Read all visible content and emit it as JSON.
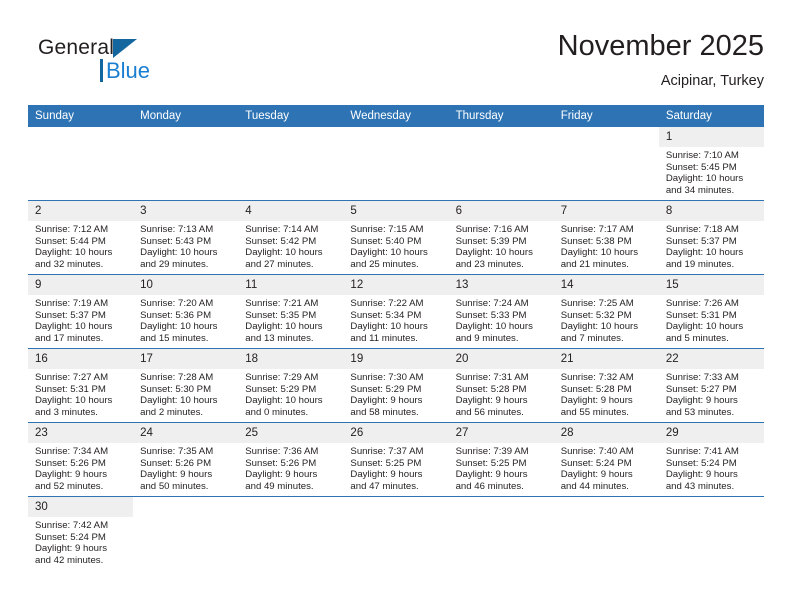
{
  "brand": {
    "name_top": "General",
    "name_bottom": "Blue",
    "accent_color": "#14679e",
    "blue_text_color": "#1b7fd1"
  },
  "header": {
    "month_title": "November 2025",
    "location": "Acipinar, Turkey"
  },
  "theme": {
    "header_blue": "#2e74b5",
    "daynum_gray": "#efefef",
    "text": "#231f20"
  },
  "weekday_headers": [
    "Sunday",
    "Monday",
    "Tuesday",
    "Wednesday",
    "Thursday",
    "Friday",
    "Saturday"
  ],
  "weeks": [
    [
      {
        "day": "",
        "empty": true
      },
      {
        "day": "",
        "empty": true
      },
      {
        "day": "",
        "empty": true
      },
      {
        "day": "",
        "empty": true
      },
      {
        "day": "",
        "empty": true
      },
      {
        "day": "",
        "empty": true
      },
      {
        "day": "1",
        "sunrise": "Sunrise: 7:10 AM",
        "sunset": "Sunset: 5:45 PM",
        "daylight_1": "Daylight: 10 hours",
        "daylight_2": "and 34 minutes."
      }
    ],
    [
      {
        "day": "2",
        "sunrise": "Sunrise: 7:12 AM",
        "sunset": "Sunset: 5:44 PM",
        "daylight_1": "Daylight: 10 hours",
        "daylight_2": "and 32 minutes."
      },
      {
        "day": "3",
        "sunrise": "Sunrise: 7:13 AM",
        "sunset": "Sunset: 5:43 PM",
        "daylight_1": "Daylight: 10 hours",
        "daylight_2": "and 29 minutes."
      },
      {
        "day": "4",
        "sunrise": "Sunrise: 7:14 AM",
        "sunset": "Sunset: 5:42 PM",
        "daylight_1": "Daylight: 10 hours",
        "daylight_2": "and 27 minutes."
      },
      {
        "day": "5",
        "sunrise": "Sunrise: 7:15 AM",
        "sunset": "Sunset: 5:40 PM",
        "daylight_1": "Daylight: 10 hours",
        "daylight_2": "and 25 minutes."
      },
      {
        "day": "6",
        "sunrise": "Sunrise: 7:16 AM",
        "sunset": "Sunset: 5:39 PM",
        "daylight_1": "Daylight: 10 hours",
        "daylight_2": "and 23 minutes."
      },
      {
        "day": "7",
        "sunrise": "Sunrise: 7:17 AM",
        "sunset": "Sunset: 5:38 PM",
        "daylight_1": "Daylight: 10 hours",
        "daylight_2": "and 21 minutes."
      },
      {
        "day": "8",
        "sunrise": "Sunrise: 7:18 AM",
        "sunset": "Sunset: 5:37 PM",
        "daylight_1": "Daylight: 10 hours",
        "daylight_2": "and 19 minutes."
      }
    ],
    [
      {
        "day": "9",
        "sunrise": "Sunrise: 7:19 AM",
        "sunset": "Sunset: 5:37 PM",
        "daylight_1": "Daylight: 10 hours",
        "daylight_2": "and 17 minutes."
      },
      {
        "day": "10",
        "sunrise": "Sunrise: 7:20 AM",
        "sunset": "Sunset: 5:36 PM",
        "daylight_1": "Daylight: 10 hours",
        "daylight_2": "and 15 minutes."
      },
      {
        "day": "11",
        "sunrise": "Sunrise: 7:21 AM",
        "sunset": "Sunset: 5:35 PM",
        "daylight_1": "Daylight: 10 hours",
        "daylight_2": "and 13 minutes."
      },
      {
        "day": "12",
        "sunrise": "Sunrise: 7:22 AM",
        "sunset": "Sunset: 5:34 PM",
        "daylight_1": "Daylight: 10 hours",
        "daylight_2": "and 11 minutes."
      },
      {
        "day": "13",
        "sunrise": "Sunrise: 7:24 AM",
        "sunset": "Sunset: 5:33 PM",
        "daylight_1": "Daylight: 10 hours",
        "daylight_2": "and 9 minutes."
      },
      {
        "day": "14",
        "sunrise": "Sunrise: 7:25 AM",
        "sunset": "Sunset: 5:32 PM",
        "daylight_1": "Daylight: 10 hours",
        "daylight_2": "and 7 minutes."
      },
      {
        "day": "15",
        "sunrise": "Sunrise: 7:26 AM",
        "sunset": "Sunset: 5:31 PM",
        "daylight_1": "Daylight: 10 hours",
        "daylight_2": "and 5 minutes."
      }
    ],
    [
      {
        "day": "16",
        "sunrise": "Sunrise: 7:27 AM",
        "sunset": "Sunset: 5:31 PM",
        "daylight_1": "Daylight: 10 hours",
        "daylight_2": "and 3 minutes."
      },
      {
        "day": "17",
        "sunrise": "Sunrise: 7:28 AM",
        "sunset": "Sunset: 5:30 PM",
        "daylight_1": "Daylight: 10 hours",
        "daylight_2": "and 2 minutes."
      },
      {
        "day": "18",
        "sunrise": "Sunrise: 7:29 AM",
        "sunset": "Sunset: 5:29 PM",
        "daylight_1": "Daylight: 10 hours",
        "daylight_2": "and 0 minutes."
      },
      {
        "day": "19",
        "sunrise": "Sunrise: 7:30 AM",
        "sunset": "Sunset: 5:29 PM",
        "daylight_1": "Daylight: 9 hours",
        "daylight_2": "and 58 minutes."
      },
      {
        "day": "20",
        "sunrise": "Sunrise: 7:31 AM",
        "sunset": "Sunset: 5:28 PM",
        "daylight_1": "Daylight: 9 hours",
        "daylight_2": "and 56 minutes."
      },
      {
        "day": "21",
        "sunrise": "Sunrise: 7:32 AM",
        "sunset": "Sunset: 5:28 PM",
        "daylight_1": "Daylight: 9 hours",
        "daylight_2": "and 55 minutes."
      },
      {
        "day": "22",
        "sunrise": "Sunrise: 7:33 AM",
        "sunset": "Sunset: 5:27 PM",
        "daylight_1": "Daylight: 9 hours",
        "daylight_2": "and 53 minutes."
      }
    ],
    [
      {
        "day": "23",
        "sunrise": "Sunrise: 7:34 AM",
        "sunset": "Sunset: 5:26 PM",
        "daylight_1": "Daylight: 9 hours",
        "daylight_2": "and 52 minutes."
      },
      {
        "day": "24",
        "sunrise": "Sunrise: 7:35 AM",
        "sunset": "Sunset: 5:26 PM",
        "daylight_1": "Daylight: 9 hours",
        "daylight_2": "and 50 minutes."
      },
      {
        "day": "25",
        "sunrise": "Sunrise: 7:36 AM",
        "sunset": "Sunset: 5:26 PM",
        "daylight_1": "Daylight: 9 hours",
        "daylight_2": "and 49 minutes."
      },
      {
        "day": "26",
        "sunrise": "Sunrise: 7:37 AM",
        "sunset": "Sunset: 5:25 PM",
        "daylight_1": "Daylight: 9 hours",
        "daylight_2": "and 47 minutes."
      },
      {
        "day": "27",
        "sunrise": "Sunrise: 7:39 AM",
        "sunset": "Sunset: 5:25 PM",
        "daylight_1": "Daylight: 9 hours",
        "daylight_2": "and 46 minutes."
      },
      {
        "day": "28",
        "sunrise": "Sunrise: 7:40 AM",
        "sunset": "Sunset: 5:24 PM",
        "daylight_1": "Daylight: 9 hours",
        "daylight_2": "and 44 minutes."
      },
      {
        "day": "29",
        "sunrise": "Sunrise: 7:41 AM",
        "sunset": "Sunset: 5:24 PM",
        "daylight_1": "Daylight: 9 hours",
        "daylight_2": "and 43 minutes."
      }
    ],
    [
      {
        "day": "30",
        "sunrise": "Sunrise: 7:42 AM",
        "sunset": "Sunset: 5:24 PM",
        "daylight_1": "Daylight: 9 hours",
        "daylight_2": "and 42 minutes."
      },
      {
        "day": "",
        "empty": true
      },
      {
        "day": "",
        "empty": true
      },
      {
        "day": "",
        "empty": true
      },
      {
        "day": "",
        "empty": true
      },
      {
        "day": "",
        "empty": true
      },
      {
        "day": "",
        "empty": true
      }
    ]
  ]
}
